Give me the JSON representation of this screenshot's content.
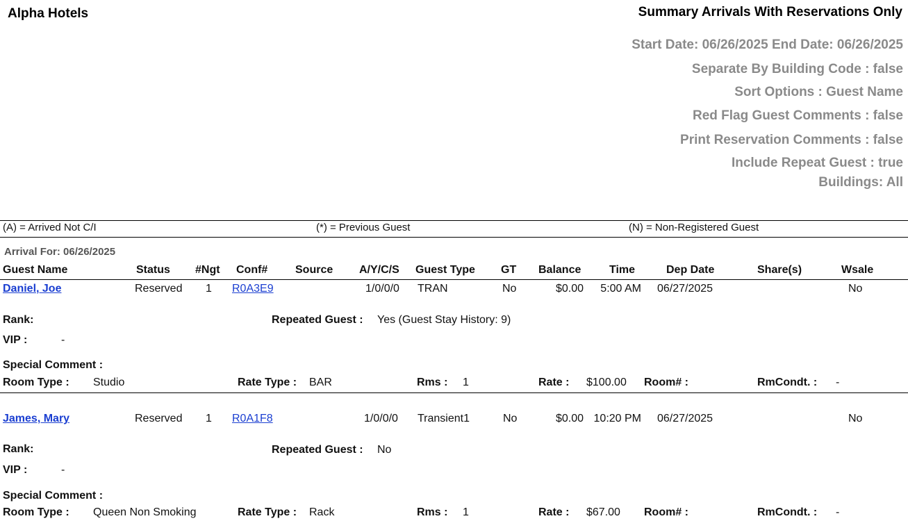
{
  "header": {
    "hotel_name": "Alpha Hotels",
    "report_title": "Summary Arrivals With Reservations Only",
    "params": [
      "Start Date: 06/26/2025 End Date: 06/26/2025",
      "Separate By Building Code : false",
      "Sort Options : Guest Name",
      "Red Flag Guest Comments : false",
      "Print Reservation Comments : false",
      "Include Repeat Guest : true",
      "Buildings: All"
    ]
  },
  "legend": {
    "arrived": "(A) = Arrived Not C/I",
    "previous": "(*) = Previous Guest",
    "nonreg": "(N) = Non-Registered Guest"
  },
  "arrival_for": "Arrival For: 06/26/2025",
  "columns": {
    "guest_name": "Guest Name",
    "status": "Status",
    "ngt": "#Ngt",
    "conf": "Conf#",
    "source": "Source",
    "aycs": "A/Y/C/S",
    "guest_type": "Guest Type",
    "gt": "GT",
    "balance": "Balance",
    "time": "Time",
    "dep_date": "Dep Date",
    "shares": "Share(s)",
    "wsale": "Wsale"
  },
  "labels": {
    "rank": "Rank:",
    "vip": "VIP :",
    "repeated": "Repeated Guest :",
    "special": "Special Comment :",
    "room_type": "Room Type :",
    "rate_type": "Rate Type :",
    "rms": "Rms :",
    "rate": "Rate :",
    "room_no": "Room# :",
    "rmcondt": "RmCondt. :"
  },
  "reservations": [
    {
      "guest_name": "Daniel, Joe",
      "status": "Reserved",
      "ngt": "1",
      "conf": "R0A3E9",
      "source": "",
      "aycs": "1/0/0/0",
      "guest_type": "TRAN",
      "gt": "No",
      "balance": "$0.00",
      "time": "5:00 AM",
      "dep_date": "06/27/2025",
      "shares": "",
      "wsale": "No",
      "rank": "",
      "vip": "-",
      "repeated": "Yes (Guest Stay History: 9)",
      "special": "",
      "room_type": "Studio",
      "rate_type": "BAR",
      "rms": "1",
      "rate": "$100.00",
      "room_no": "",
      "rmcondt": "-"
    },
    {
      "guest_name": "James, Mary",
      "status": "Reserved",
      "ngt": "1",
      "conf": "R0A1F8",
      "source": "",
      "aycs": "1/0/0/0",
      "guest_type": "Transient1",
      "gt": "No",
      "balance": "$0.00",
      "time": "10:20 PM",
      "dep_date": "06/27/2025",
      "shares": "",
      "wsale": "No",
      "rank": "",
      "vip": "-",
      "repeated": "No",
      "special": "",
      "room_type": "Queen Non Smoking",
      "rate_type": "Rack",
      "rms": "1",
      "rate": "$67.00",
      "room_no": "",
      "rmcondt": "-"
    }
  ]
}
